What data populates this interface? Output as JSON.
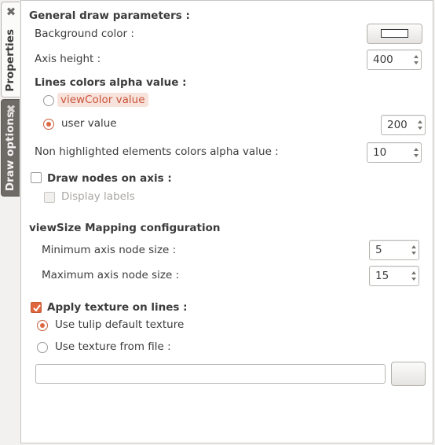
{
  "tabs": [
    {
      "label": "Properties",
      "active": true,
      "close_icon": "close-icon"
    },
    {
      "label": "Draw options",
      "active": false,
      "close_icon": "close-icon"
    }
  ],
  "general": {
    "title": "General draw parameters :",
    "background_color_label": "Background color :",
    "background_color_value": "#ffffff",
    "axis_height_label": "Axis height :",
    "axis_height_value": "400"
  },
  "alpha": {
    "title": "Lines colors alpha value :",
    "option_viewcolor": "viewColor value",
    "option_user": "user value",
    "user_value": "200",
    "selected": "user value",
    "non_highlighted_label": "Non highlighted elements colors alpha value :",
    "non_highlighted_value": "10"
  },
  "nodes": {
    "draw_nodes_label": "Draw nodes on axis :",
    "draw_nodes_checked": false,
    "display_labels_label": "Display labels",
    "display_labels_checked": false
  },
  "viewsize": {
    "title": "viewSize Mapping configuration",
    "min_label": "Minimum axis node size :",
    "min_value": "5",
    "max_label": "Maximum axis node size :",
    "max_value": "15"
  },
  "texture": {
    "apply_label": "Apply texture on lines :",
    "apply_checked": true,
    "option_default": "Use tulip default texture",
    "option_file": "Use texture from file :",
    "selected": "Use tulip default texture",
    "file_path": "",
    "browse_label": ""
  },
  "colors": {
    "accent": "#dd6a43",
    "highlight_bg": "#f8e3dc"
  }
}
